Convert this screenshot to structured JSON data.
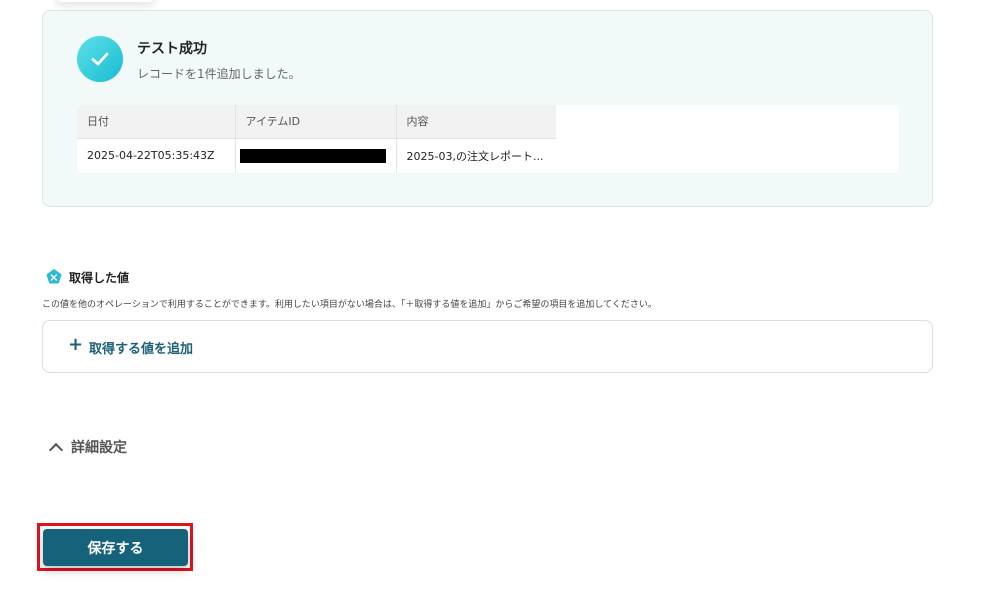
{
  "success": {
    "title": "テスト成功",
    "subtitle": "レコードを1件追加しました。",
    "table": {
      "headers": [
        "日付",
        "アイテムID",
        "内容"
      ],
      "row": {
        "date": "2025-04-22T05:35:43Z",
        "item_id": "",
        "content": "2025-03,の注文レポート..."
      }
    }
  },
  "acquired": {
    "title": "取得した値",
    "description": "この値を他のオペレーションで利用することができます。利用したい項目がない場合は、「＋取得する値を追加」からご希望の項目を追加してください。",
    "add_label": "取得する値を追加"
  },
  "details": {
    "label": "詳細設定"
  },
  "footer": {
    "save_label": "保存する"
  },
  "colors": {
    "accent": "#16627a",
    "highlight": "#e0141e",
    "success": "#17bcd3"
  }
}
